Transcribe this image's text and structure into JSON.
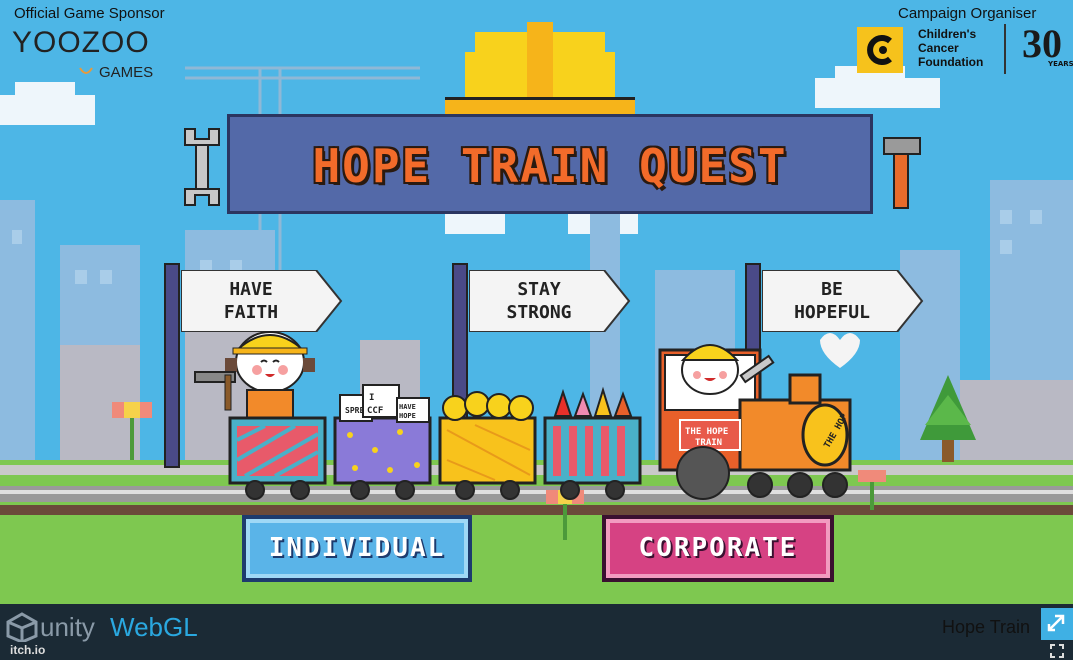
{
  "sponsor": {
    "label": "Official Game Sponsor",
    "brand": "YOOZOO",
    "sub": "GAMES"
  },
  "organiser": {
    "label": "Campaign Organiser",
    "line1": "Children's",
    "line2": "Cancer",
    "line3": "Foundation",
    "anniversary": "30",
    "years": "YEARS"
  },
  "title": "HOPE TRAIN QUEST",
  "signs": [
    {
      "line1": "HAVE",
      "line2": "FAITH"
    },
    {
      "line1": "STAY",
      "line2": "STRONG"
    },
    {
      "line1": "BE",
      "line2": "HOPEFUL"
    }
  ],
  "train": {
    "engine_label_1": "THE HOPE",
    "engine_label_2": "TRAIN",
    "boiler_label": "THE HOP",
    "cart_signs": [
      "SPRE",
      "I",
      "CCF",
      "HAVE",
      "HOPE"
    ]
  },
  "buttons": {
    "individual": "INDIVIDUAL",
    "corporate": "CORPORATE"
  },
  "footer": {
    "unity": "unity",
    "webgl": "WebGL",
    "game_name": "Hope Train",
    "itch": "itch.io"
  },
  "colors": {
    "sky": "#4db6e6",
    "title_orange": "#f26b2a",
    "board_blue": "#5369a8",
    "grass": "#7ec850",
    "individual_blue": "#5ab4e8",
    "corporate_pink": "#d64283"
  },
  "icons": [
    "wrench-icon",
    "hammer-icon",
    "hardhat-icon",
    "unity-logo-icon",
    "fullscreen-icon"
  ]
}
